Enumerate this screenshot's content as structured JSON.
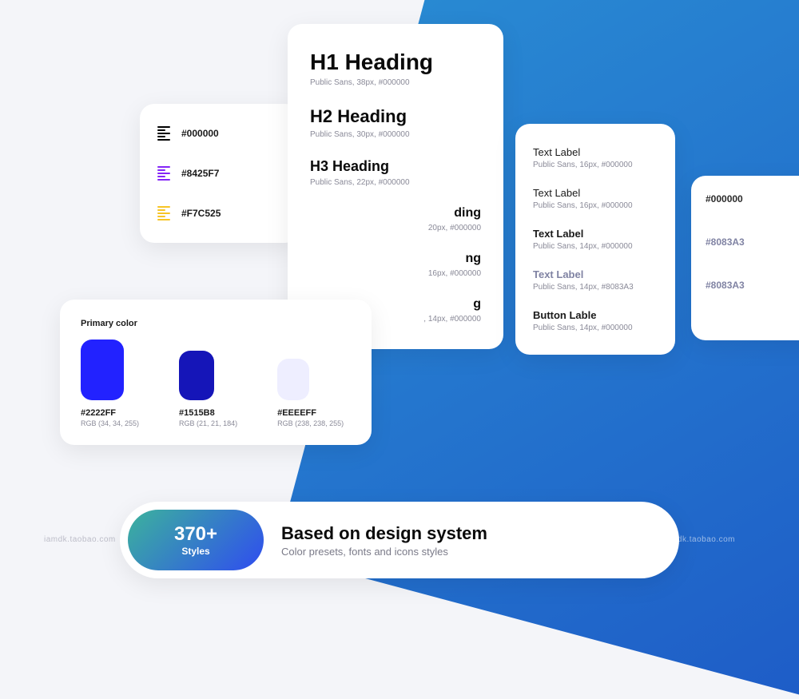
{
  "colors_list": [
    {
      "hex": "#000000",
      "icon_color": "#000000"
    },
    {
      "hex": "#8425F7",
      "icon_color": "#8425F7"
    },
    {
      "hex": "#F7C525",
      "icon_color": "#F7C525"
    }
  ],
  "typography": [
    {
      "title": "H1 Heading",
      "meta": "Public Sans, 38px, #000000"
    },
    {
      "title": "H2 Heading",
      "meta": "Public Sans, 30px, #000000"
    },
    {
      "title": "H3 Heading",
      "meta": "Public Sans, 22px, #000000"
    },
    {
      "title": "ding",
      "meta": "20px, #000000"
    },
    {
      "title": "ng",
      "meta": "16px, #000000"
    },
    {
      "title": "g",
      "meta": ", 14px, #000000"
    }
  ],
  "text_labels": [
    {
      "title": "Text Label",
      "meta": "Public Sans, 16px, #000000",
      "weight": "normal"
    },
    {
      "title": "Text Label",
      "meta": "Public Sans, 16px, #000000",
      "weight": "normal"
    },
    {
      "title": "Text Label",
      "meta": "Public Sans, 14px, #000000",
      "weight": "bold"
    },
    {
      "title": "Text Label",
      "meta": "Public Sans, 14px, #8083A3",
      "weight": "grey"
    },
    {
      "title": "Button Lable",
      "meta": "Public Sans, 14px, #000000",
      "weight": "bold"
    }
  ],
  "peek_labels": [
    {
      "text": "#000000",
      "grey": false
    },
    {
      "text": "#8083A3",
      "grey": true
    },
    {
      "text": "#8083A3",
      "grey": true
    }
  ],
  "primary": {
    "title": "Primary color",
    "swatches": [
      {
        "hex": "#2222FF",
        "rgb": "RGB (34, 34, 255)",
        "color": "#2222FF"
      },
      {
        "hex": "#1515B8",
        "rgb": "RGB (21, 21, 184)",
        "color": "#1515B8"
      },
      {
        "hex": "#EEEEFF",
        "rgb": "RGB (238, 238, 255)",
        "color": "#EEEEFF"
      }
    ]
  },
  "pill": {
    "count": "370+",
    "sub": "Styles",
    "title": "Based on design system",
    "desc": "Color presets, fonts and icons styles"
  },
  "watermark": "iamdk.taobao.com"
}
